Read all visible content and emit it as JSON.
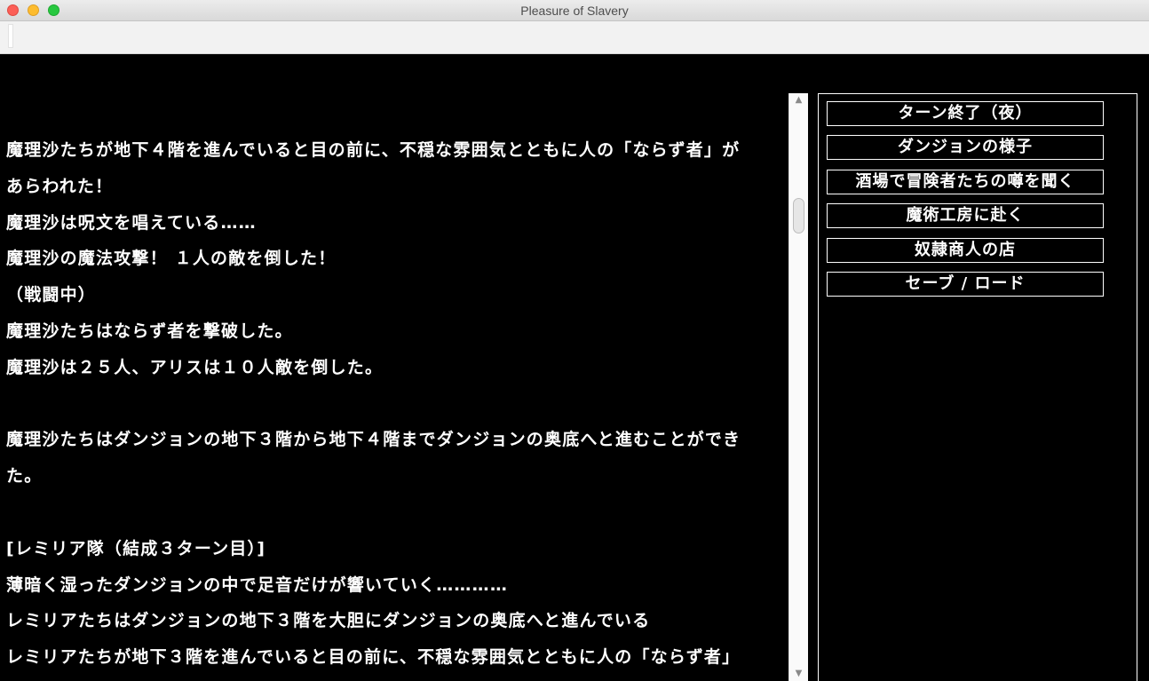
{
  "window": {
    "title": "Pleasure of Slavery"
  },
  "input": {
    "value": ""
  },
  "log": [
    "魔理沙たちが地下４階を進んでいると目の前に、不穏な雰囲気とともに人の「ならず者」が",
    "あらわれた！",
    "魔理沙は呪文を唱えている……",
    "魔理沙の魔法攻撃！ １人の敵を倒した！",
    "（戦闘中）",
    "魔理沙たちはならず者を撃破した。",
    "魔理沙は２５人、アリスは１０人敵を倒した。",
    "",
    "魔理沙たちはダンジョンの地下３階から地下４階までダンジョンの奥底へと進むことができ",
    "た。",
    "",
    "[レミリア隊（結成３ターン目）]",
    "薄暗く湿ったダンジョンの中で足音だけが響いていく…………",
    "レミリアたちはダンジョンの地下３階を大胆にダンジョンの奥底へと進んでいる",
    "レミリアたちが地下３階を進んでいると目の前に、不穏な雰囲気とともに人の「ならず者」"
  ],
  "scrollbar": {
    "up_arrow": "▲",
    "down_arrow": "▼"
  },
  "menu": {
    "buttons": [
      "ターン終了（夜）",
      "ダンジョンの様子",
      "酒場で冒険者たちの噂を聞く",
      "魔術工房に赴く",
      "奴隷商人の店",
      "セーブ / ロード"
    ]
  }
}
